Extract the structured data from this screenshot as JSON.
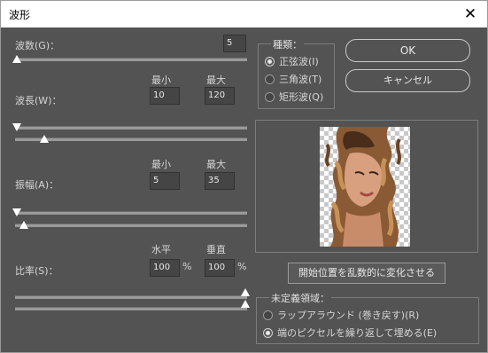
{
  "window": {
    "title": "波形",
    "close_glyph": "✕"
  },
  "generators": {
    "label": "波数(G)：",
    "value": "5"
  },
  "wavelength": {
    "label": "波長(W)：",
    "min_label": "最小",
    "max_label": "最大",
    "min": "10",
    "max": "120"
  },
  "amplitude": {
    "label": "振幅(A)：",
    "min_label": "最小",
    "max_label": "最大",
    "min": "5",
    "max": "35"
  },
  "scale": {
    "label": "比率(S)：",
    "h_label": "水平",
    "v_label": "垂直",
    "h": "100",
    "v": "100",
    "unit": "%"
  },
  "type_group": {
    "legend": "種類：",
    "options": [
      "正弦波(I)",
      "三角波(T)",
      "矩形波(Q)"
    ],
    "selected_index": 0
  },
  "buttons": {
    "ok": "OK",
    "cancel": "キャンセル",
    "randomize": "開始位置を乱数的に変化させる"
  },
  "undefined_group": {
    "legend": "未定義領域：",
    "options": [
      "ラップアラウンド (巻き戻す)(R)",
      "端のピクセルを繰り返して埋める(E)"
    ],
    "selected_index": 1
  },
  "preview": {
    "icon": "wave-distorted-portrait-preview"
  },
  "colors": {
    "dialog_bg": "#535353",
    "title_bg": "#ffffff",
    "accent_thumb": "#ffffff"
  }
}
